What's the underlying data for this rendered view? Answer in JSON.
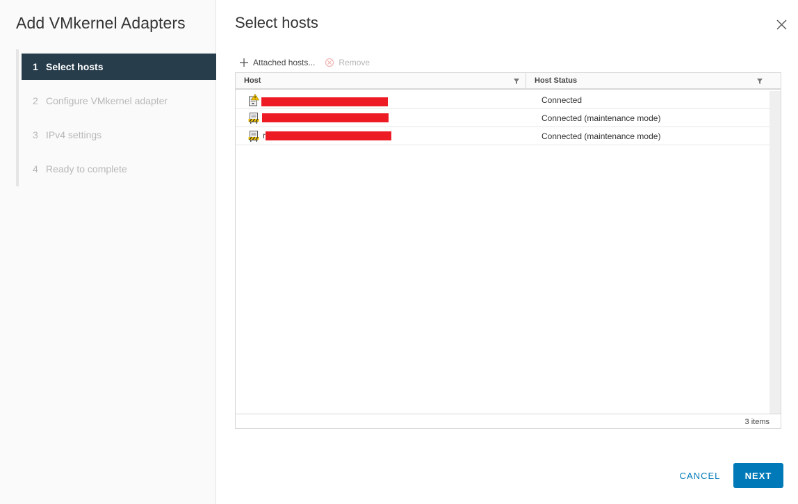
{
  "wizard": {
    "title": "Add VMkernel Adapters",
    "steps": [
      {
        "num": "1",
        "label": "Select hosts",
        "active": true
      },
      {
        "num": "2",
        "label": "Configure VMkernel adapter",
        "active": false
      },
      {
        "num": "3",
        "label": "IPv4 settings",
        "active": false
      },
      {
        "num": "4",
        "label": "Ready to complete",
        "active": false
      }
    ]
  },
  "page": {
    "title": "Select hosts"
  },
  "toolbar": {
    "attached_hosts_label": "Attached hosts...",
    "remove_label": "Remove"
  },
  "grid": {
    "columns": [
      "Host",
      "Host Status"
    ],
    "rows": [
      {
        "host_icon": "host-warning-icon",
        "host_visible_prefix": "",
        "status": "Connected"
      },
      {
        "host_icon": "host-maintenance-icon",
        "host_visible_prefix": "",
        "status": "Connected (maintenance mode)"
      },
      {
        "host_icon": "host-maintenance-icon",
        "host_visible_prefix": "r",
        "status": "Connected (maintenance mode)"
      }
    ],
    "item_count": "3 items"
  },
  "footer": {
    "cancel_label": "CANCEL",
    "next_label": "NEXT"
  },
  "colors": {
    "active_step": "#273d4c",
    "primary": "#0079b8",
    "redaction": "#ed1c24"
  }
}
